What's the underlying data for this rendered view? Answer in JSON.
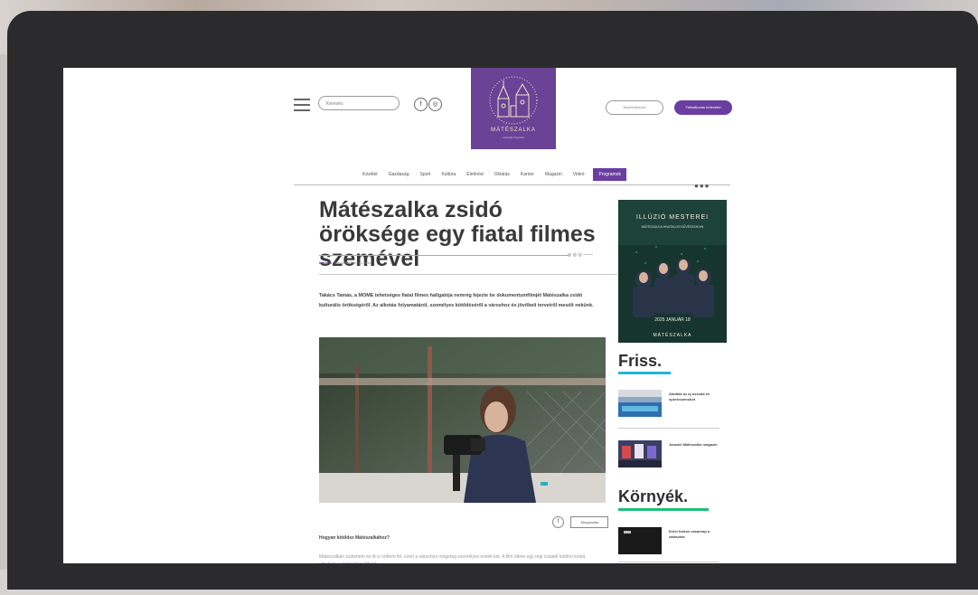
{
  "header": {
    "search_placeholder": "Keresés",
    "logo_text": "MÁTÉSZALKA",
    "logo_sub": "szatmári hírportál",
    "login_label": "Bejelentkezés",
    "subscribe_label": "Feliratkozás hírlevélre"
  },
  "nav": {
    "items": [
      "Közélet",
      "Gazdaság",
      "Sport",
      "Kultúra",
      "Életmód",
      "Oktatás",
      "Karrier",
      "Magazin",
      "Videó"
    ],
    "active": "Programok"
  },
  "article": {
    "title": "Mátészalka zsidó öröksége egy fiatal filmes szemével",
    "category": "Kultúra",
    "byline": "| szerkesztőség | 1 perc",
    "lead": "Takács Tamás, a MOME tehetséges fiatal filmes hallgatója nemrég fejezte be dokumentumfilmjét Mátészalka zsidó kulturális örökségéről. Az alkotás folyamatáról, személyes kötődéséről a városhoz és jövőbeli terveiről mesélt nekünk.",
    "share_label": "Megosztás",
    "question": "Hogyan kötődsz Mátészalkához?",
    "body": "Mátészalkán születtem és itt is nőttem fel, ezért a városhoz rengeteg személyes emlék köt. A film ötlete egy régi családi fotóból indult, amelyen a zsinagóga látható."
  },
  "sidebar": {
    "ad_title": "ILLÚZIÓ MESTEREI",
    "ad_sub": "MÁTÉSZALKA HIVATALOS BŰVÉSZSHOW",
    "ad_date": "2025 JANUÁR 18",
    "ad_city": "MÁTÉSZALKA",
    "friss_title": "Friss.",
    "friss_items": [
      {
        "text": "Átadták az új uszoda és sportcsarnokot"
      },
      {
        "text": "Januári Mátészalka magazin"
      }
    ],
    "kornyek_title": "Környék.",
    "kornyek_items": [
      {
        "text": "Ezért fontos vasárnap a választás"
      }
    ]
  },
  "colors": {
    "brand_purple": "#6a3ea0",
    "friss_underline": "#1fb6d9",
    "kornyek_underline": "#1fbf7a"
  }
}
